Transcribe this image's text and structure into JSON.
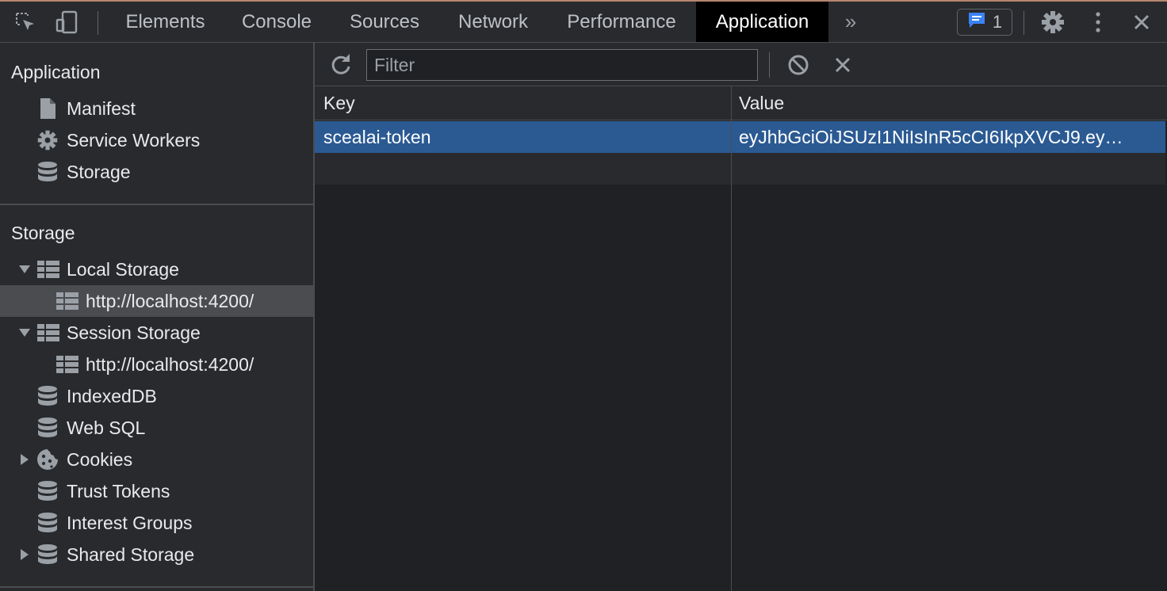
{
  "tabbar": {
    "icons": {
      "inspect": "inspect-element-icon",
      "device": "device-toolbar-icon"
    },
    "tabs": [
      {
        "label": "Elements"
      },
      {
        "label": "Console"
      },
      {
        "label": "Sources"
      },
      {
        "label": "Network"
      },
      {
        "label": "Performance"
      },
      {
        "label": "Application"
      }
    ],
    "active_tab": "Application",
    "more_tabs": "»",
    "issues_count": "1"
  },
  "sidebar": {
    "application": {
      "title": "Application",
      "items": [
        {
          "label": "Manifest",
          "icon": "file-icon"
        },
        {
          "label": "Service Workers",
          "icon": "gear-icon"
        },
        {
          "label": "Storage",
          "icon": "database-icon"
        }
      ]
    },
    "storage": {
      "title": "Storage",
      "items": [
        {
          "label": "Local Storage",
          "icon": "grid-icon",
          "expanded": true
        },
        {
          "label": "http://localhost:4200/",
          "icon": "grid-icon",
          "selected": true
        },
        {
          "label": "Session Storage",
          "icon": "grid-icon",
          "expanded": true
        },
        {
          "label": "http://localhost:4200/",
          "icon": "grid-icon"
        },
        {
          "label": "IndexedDB",
          "icon": "database-icon"
        },
        {
          "label": "Web SQL",
          "icon": "database-icon"
        },
        {
          "label": "Cookies",
          "icon": "cookie-icon",
          "expanded": false
        },
        {
          "label": "Trust Tokens",
          "icon": "database-icon"
        },
        {
          "label": "Interest Groups",
          "icon": "database-icon"
        },
        {
          "label": "Shared Storage",
          "icon": "database-icon",
          "expanded": false
        }
      ]
    }
  },
  "toolbar": {
    "filter_placeholder": "Filter"
  },
  "table": {
    "columns": [
      "Key",
      "Value"
    ],
    "rows": [
      {
        "key": "scealai-token",
        "value": "eyJhbGciOiJSUzI1NiIsInR5cCI6IkpXVCJ9.ey…"
      }
    ]
  },
  "colors": {
    "selected_row": "#2b5a93",
    "active_tab_bg": "#000000",
    "accent_blue": "#3b82f6"
  }
}
